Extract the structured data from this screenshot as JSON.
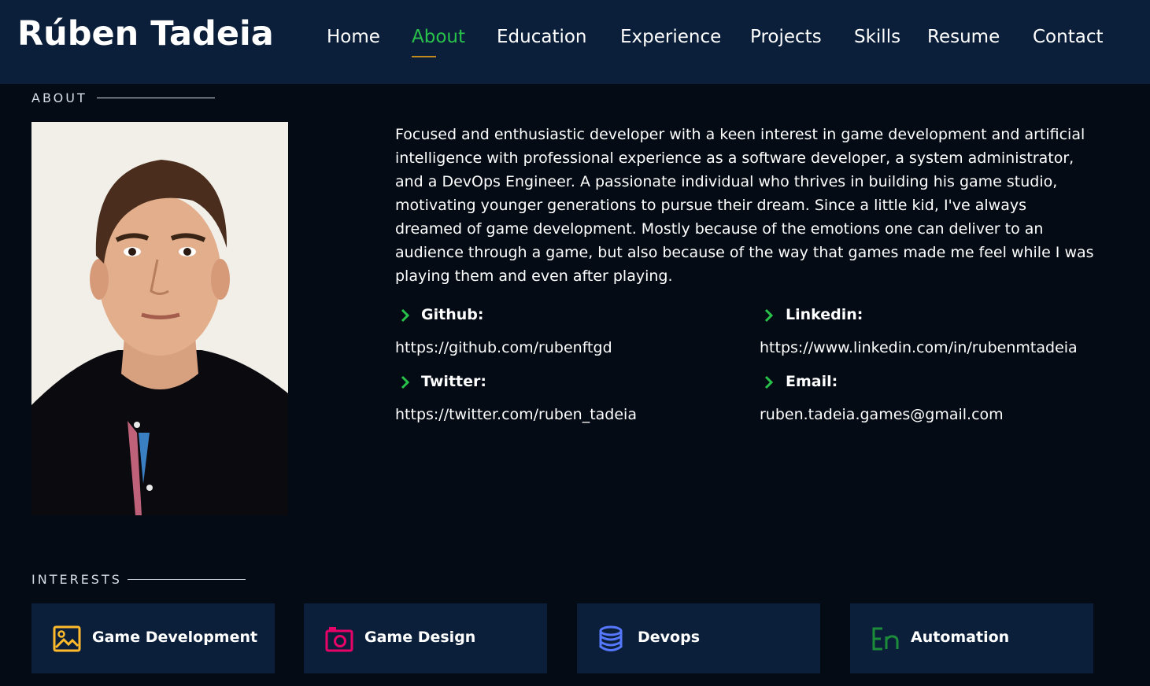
{
  "header": {
    "brand": "Rúben Tadeia",
    "nav": [
      {
        "label": "Home",
        "active": false
      },
      {
        "label": "About",
        "active": true
      },
      {
        "label": "Education",
        "active": false
      },
      {
        "label": "Experience",
        "active": false
      },
      {
        "label": "Projects",
        "active": false
      },
      {
        "label": "Skills",
        "active": false
      },
      {
        "label": "Resume",
        "active": false
      },
      {
        "label": "Contact",
        "active": false
      }
    ]
  },
  "about": {
    "title": "ABOUT",
    "bio": "Focused and enthusiastic developer with a keen interest in game development and artificial intelligence with professional experience as a software developer, a system administrator, and a DevOps Engineer. A passionate individual who thrives in building his game studio, motivating younger generations to pursue their dream. Since a little kid, I've always dreamed of game development. Mostly because of the emotions one can deliver to an audience through a game, but also because of the way that games made me feel while I was playing them and even after playing.",
    "links": [
      {
        "label": "Github:",
        "value": "https://github.com/rubenftgd"
      },
      {
        "label": "Linkedin:",
        "value": "https://www.linkedin.com/in/rubenmtadeia"
      },
      {
        "label": "Twitter:",
        "value": "https://twitter.com/ruben_tadeia"
      },
      {
        "label": "Email:",
        "value": "ruben.tadeia.games@gmail.com"
      }
    ]
  },
  "interests": {
    "title": "INTERESTS",
    "items": [
      {
        "label": "Game Development",
        "icon": "image-icon",
        "color": "#ffbb2c"
      },
      {
        "label": "Game Design",
        "icon": "camera-icon",
        "color": "#e80368"
      },
      {
        "label": "Devops",
        "icon": "database-icon",
        "color": "#5578ff"
      },
      {
        "label": "Automation",
        "icon": "en-icon",
        "color": "#1c8c3b"
      }
    ]
  },
  "colors": {
    "header_bg": "#0b1f3a",
    "page_bg": "#040b14",
    "accent_green": "#28c24a",
    "underline_gold": "#c28a1a"
  }
}
